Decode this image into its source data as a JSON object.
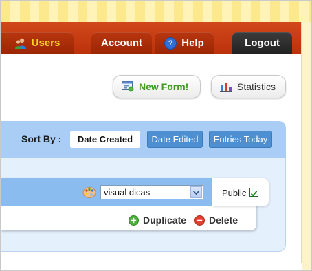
{
  "nav": {
    "users_label": "Users",
    "account_label": "Account",
    "help_label": "Help",
    "help_icon_glyph": "?",
    "logout_label": "Logout"
  },
  "toolbar": {
    "new_form_label": "New Form!",
    "statistics_label": "Statistics"
  },
  "sort": {
    "label": "Sort By :",
    "options": [
      "Date Created",
      "Date Edited",
      "Entries Today"
    ],
    "active": "Date Created"
  },
  "form": {
    "theme_selected": "visual dicas",
    "public_label": "Public",
    "public_checked": true,
    "duplicate_label": "Duplicate",
    "delete_label": "Delete"
  },
  "icons": {
    "users": "users-icon",
    "help": "help-icon",
    "new_form": "new-form-icon",
    "statistics": "bar-chart-icon",
    "theme": "palette-icon",
    "duplicate": "plus-circle-icon",
    "delete": "minus-circle-icon"
  },
  "colors": {
    "nav_bar": "#c73a12",
    "active_tab_text": "#ffd21e",
    "logout_tab": "#2e2e2e",
    "sort_bar": "#a9cdf5",
    "sort_button": "#4d8fd1",
    "list_bg": "#e5f0fd",
    "form_row": "#8bbcef",
    "new_form_text": "#3f9a1f"
  }
}
